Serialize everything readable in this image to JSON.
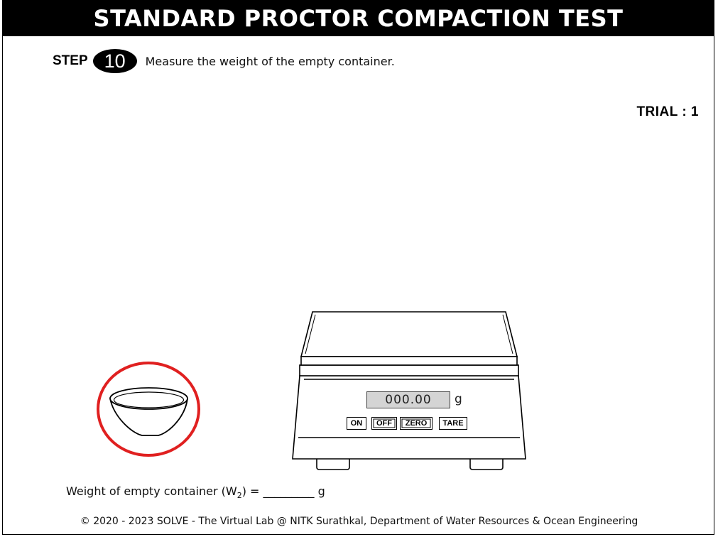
{
  "header": {
    "title": "STANDARD PROCTOR COMPACTION TEST"
  },
  "step": {
    "label": "STEP",
    "number": "10",
    "text": "Measure the weight of the empty container."
  },
  "trial": {
    "text": "TRIAL : 1"
  },
  "scale": {
    "display_value": "000.00",
    "unit": "g",
    "buttons": {
      "on": "ON",
      "off": "OFF",
      "zero": "ZERO",
      "tare": "TARE"
    }
  },
  "result": {
    "prefix": "Weight of empty container (W",
    "subscript": "2",
    "suffix": ") = _________ g"
  },
  "footer": {
    "text": "© 2020 - 2023 SOLVE - The Virtual Lab @ NITK Surathkal, Department of Water Resources & Ocean Engineering"
  },
  "colors": {
    "highlight_ring": "#e02020",
    "display_bg": "#d4d4d4"
  }
}
